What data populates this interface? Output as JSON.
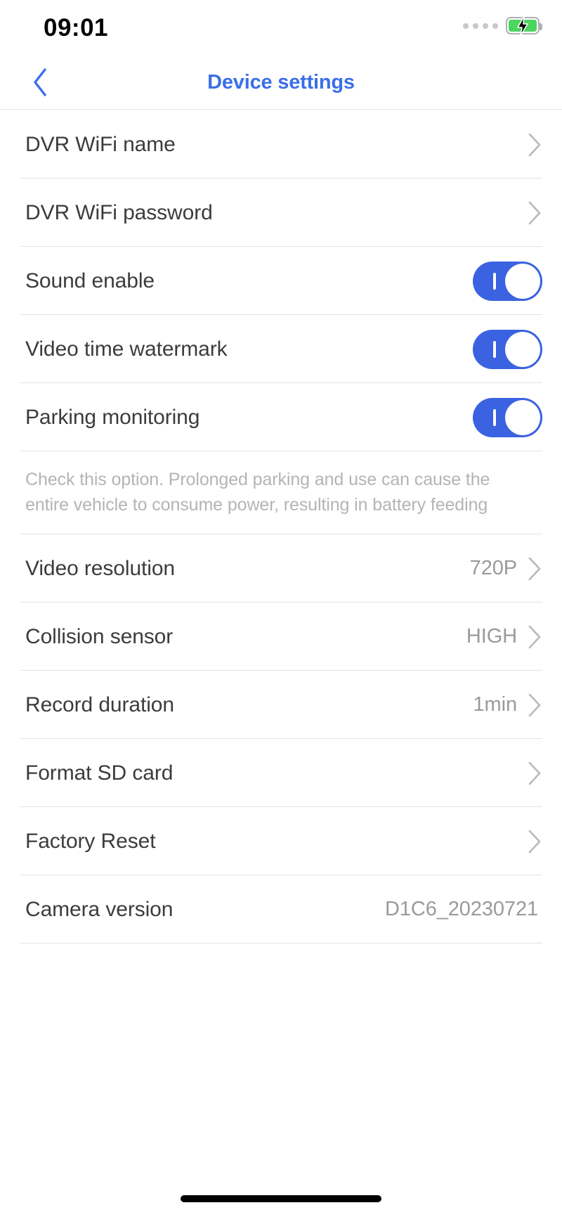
{
  "status_bar": {
    "time": "09:01",
    "signal_dots": 4,
    "battery_icon": "battery-charging-icon",
    "battery_color": "#4cd55f"
  },
  "header": {
    "back_icon": "chevron-left-icon",
    "title": "Device settings",
    "accent_color": "#3B6FE8"
  },
  "settings": {
    "rows": [
      {
        "label": "DVR WiFi name",
        "type": "link",
        "value": ""
      },
      {
        "label": "DVR WiFi password",
        "type": "link",
        "value": ""
      },
      {
        "label": "Sound enable",
        "type": "toggle",
        "value": "on"
      },
      {
        "label": "Video time watermark",
        "type": "toggle",
        "value": "on"
      },
      {
        "label": "Parking monitoring",
        "type": "toggle",
        "value": "on"
      }
    ],
    "note": {
      "line1": "Check this option. Prolonged parking and use can cause the",
      "line2": "entire vehicle to consume power, resulting in battery feeding"
    },
    "rows2": [
      {
        "label": "Video resolution",
        "type": "link",
        "value": "720P"
      },
      {
        "label": "Collision sensor",
        "type": "link",
        "value": "HIGH"
      },
      {
        "label": "Record duration",
        "type": "link",
        "value": "1min"
      },
      {
        "label": "Format SD card",
        "type": "link",
        "value": ""
      },
      {
        "label": "Factory Reset",
        "type": "link",
        "value": ""
      },
      {
        "label": "Camera version",
        "type": "value",
        "value": "D1C6_20230721"
      }
    ]
  },
  "toggle_on_color": "#3B62E0",
  "home_indicator": "home-indicator-bar"
}
